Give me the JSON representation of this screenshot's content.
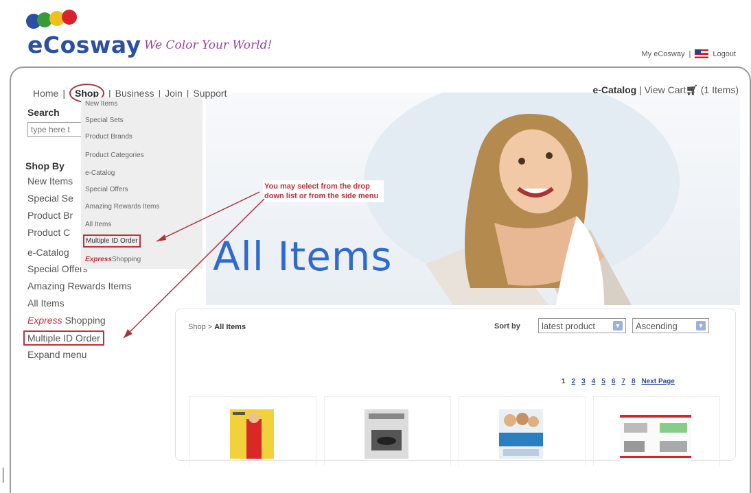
{
  "header": {
    "brand": "eCosway",
    "tagline": "We Color Your World!",
    "my_account": "My eCosway",
    "separator": "|",
    "logout": "Logout"
  },
  "nav": {
    "home": "Home",
    "shop": "Shop",
    "business": "Business",
    "join": "Join",
    "support": "Support",
    "sep": "|",
    "ecatalog": "e-Catalog",
    "view_cart": "View Cart",
    "cart_count": "(1 Items)"
  },
  "search": {
    "label": "Search",
    "placeholder": "type here t"
  },
  "sidebar": {
    "heading": "Shop By",
    "items": [
      "New Items",
      "Special Se",
      "Product Br",
      "Product C",
      "e-Catalog",
      "Special Offers",
      "Amazing Rewards Items",
      "All Items",
      "Express",
      "Shopping",
      "Multiple ID Order",
      "Expand menu"
    ]
  },
  "dropdown": {
    "items": [
      "New Items",
      "Special Sets",
      "Product Brands",
      "Product Categories",
      "e-Catalog",
      "Special Offers",
      "Amazing Rewards Items",
      "All Items",
      "Multiple ID Order",
      "Express",
      "Shopping"
    ]
  },
  "annotation": {
    "line1": "You may select from the drop",
    "line2": "down list or from the side menu"
  },
  "banner": {
    "title": "All Items"
  },
  "content": {
    "crumb_root": "Shop >",
    "crumb_current": "All Items",
    "sort_label": "Sort by",
    "sort_value": "latest product",
    "order_value": "Ascending"
  },
  "pager": {
    "pages": [
      "1",
      "2",
      "3",
      "4",
      "5",
      "6",
      "7",
      "8"
    ],
    "next": "Next Page"
  },
  "colors": {
    "brand": "#2b4fa3",
    "accent": "#c0303a",
    "title": "#2f6ad0"
  }
}
